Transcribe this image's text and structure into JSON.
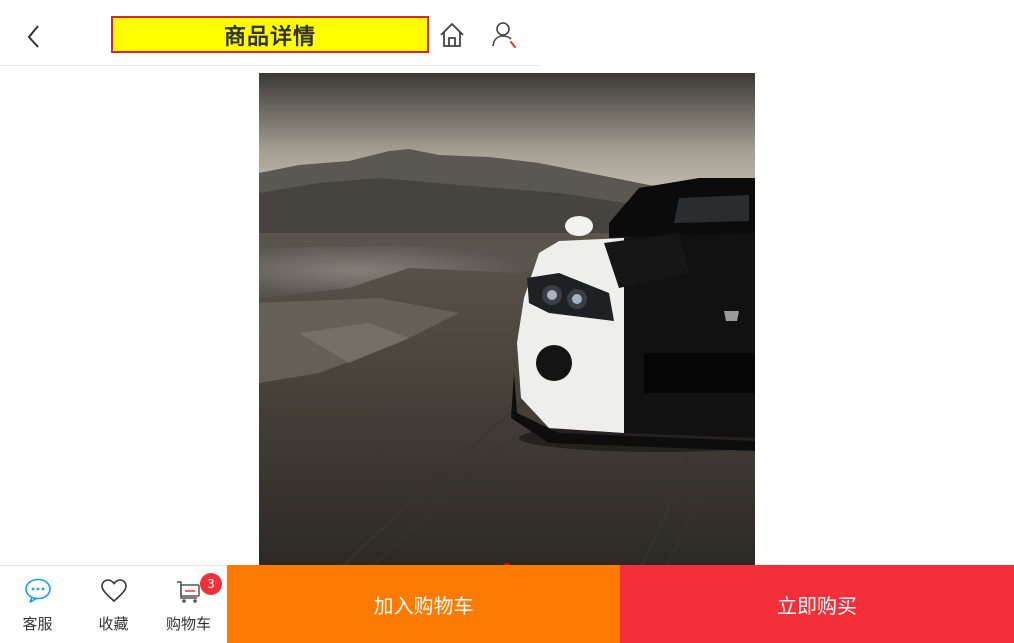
{
  "header": {
    "title": "商品详情",
    "back_icon": "chevron-left-icon",
    "home_icon": "home-icon",
    "user_icon": "user-icon"
  },
  "product": {
    "image_subject": "black and white sports car in desert"
  },
  "carousel": {
    "active_index": 1,
    "count": 1
  },
  "bottom_bar": {
    "service_label": "客服",
    "service_icon": "chat-bubble-icon",
    "favorite_label": "收藏",
    "favorite_icon": "heart-icon",
    "cart_label": "购物车",
    "cart_icon": "cart-icon",
    "cart_badge": "3",
    "add_to_cart_label": "加入购物车",
    "buy_now_label": "立即购买"
  },
  "colors": {
    "title_highlight": "#ffff00",
    "title_border": "#d6282a",
    "add_to_cart": "#ff7a00",
    "buy_now": "#f42f3a",
    "badge": "#f2303a",
    "service_icon": "#1a9cf0"
  }
}
